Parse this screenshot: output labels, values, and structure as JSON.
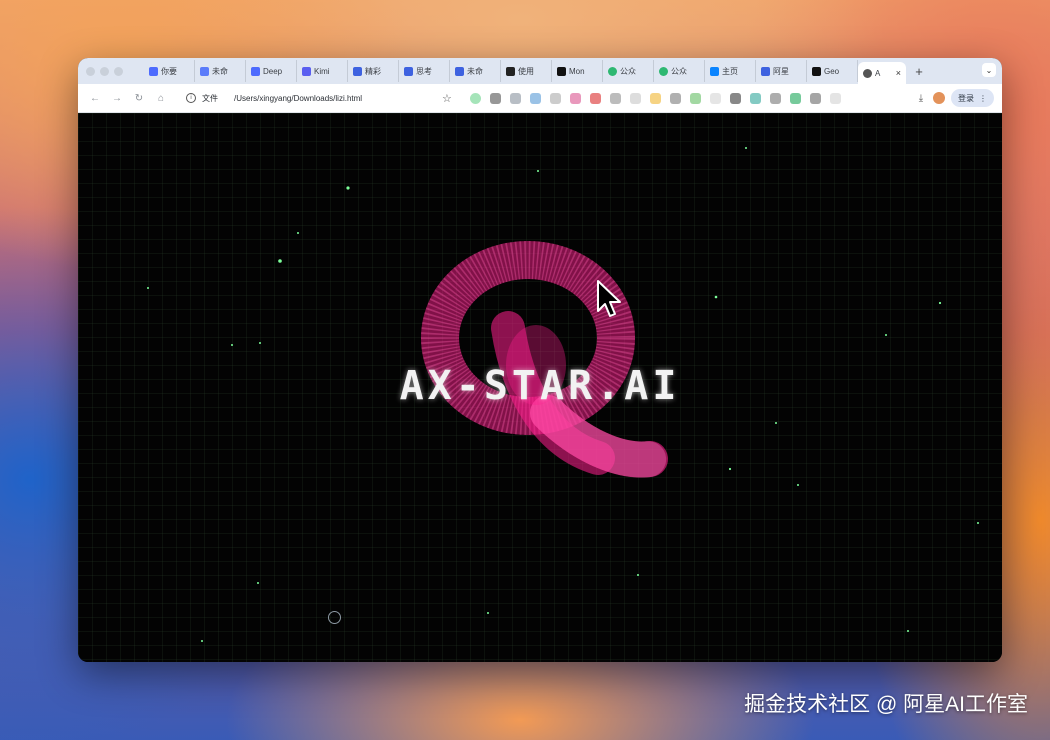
{
  "browser": {
    "tabs": [
      {
        "label": "你要",
        "fav_color": "#4d6bfe"
      },
      {
        "label": "未命",
        "fav_color": "#5b7cfa"
      },
      {
        "label": "Deep",
        "fav_color": "#4d6bfe"
      },
      {
        "label": "Kimi",
        "fav_color": "#5a5ff0"
      },
      {
        "label": "精彩",
        "fav_color": "#3e62e0"
      },
      {
        "label": "思考",
        "fav_color": "#3e62e0"
      },
      {
        "label": "未命",
        "fav_color": "#3e62e0"
      },
      {
        "label": "使用",
        "fav_color": "#222222"
      },
      {
        "label": "Mon",
        "fav_color": "#111111"
      },
      {
        "label": "公众",
        "fav_color": "#2eb872"
      },
      {
        "label": "公众",
        "fav_color": "#2eb872"
      },
      {
        "label": "主页",
        "fav_color": "#0a84ff"
      },
      {
        "label": "阿星",
        "fav_color": "#3e62e0"
      },
      {
        "label": "Geo",
        "fav_color": "#111111"
      }
    ],
    "active_tab": {
      "label": "A",
      "close": "×"
    },
    "new_tab_glyph": "+",
    "tab_menu_glyph": "⌄",
    "address": {
      "scheme_label": "文件",
      "url": "/Users/xingyang/Downloads/lizi.html"
    },
    "login_label": "登录",
    "menu_glyph": "⋮"
  },
  "page": {
    "headline": "AX-STAR.AI",
    "accent_color": "#ff1f8e"
  },
  "watermark": "掘金技术社区 @ 阿星AI工作室"
}
